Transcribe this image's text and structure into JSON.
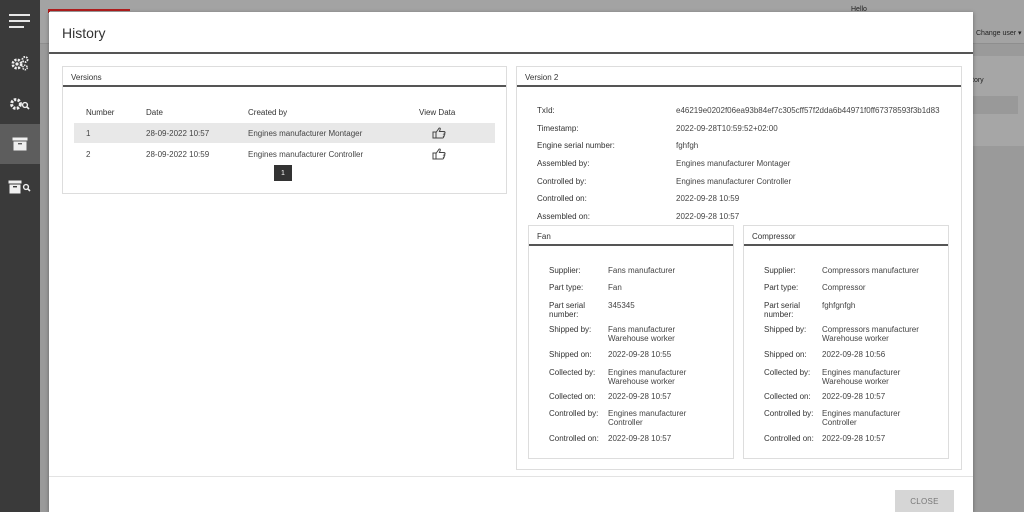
{
  "background": {
    "hello": "Hello",
    "change_user": "Change user ▾",
    "card_text": "tory"
  },
  "modal": {
    "title": "History",
    "close_label": "CLOSE"
  },
  "versions": {
    "title": "Versions",
    "columns": [
      "Number",
      "Date",
      "Created by",
      "View Data"
    ],
    "rows": [
      {
        "number": "1",
        "date": "28-09-2022 10:57",
        "created_by": "Engines manufacturer Montager"
      },
      {
        "number": "2",
        "date": "28-09-2022 10:59",
        "created_by": "Engines manufacturer Controller"
      }
    ],
    "page": "1"
  },
  "version_detail": {
    "title": "Version 2",
    "fields": [
      {
        "label": "TxId:",
        "value": "e46219e0202f06ea93b84ef7c305cff57f2dda6b44971f0ff67378593f3b1d83"
      },
      {
        "label": "Timestamp:",
        "value": "2022-09-28T10:59:52+02:00"
      },
      {
        "label": "Engine serial number:",
        "value": "fghfgh"
      },
      {
        "label": "Assembled by:",
        "value": "Engines manufacturer Montager"
      },
      {
        "label": "Controlled by:",
        "value": "Engines manufacturer Controller"
      },
      {
        "label": "Controlled on:",
        "value": "2022-09-28 10:59"
      },
      {
        "label": "Assembled on:",
        "value": "2022-09-28 10:57"
      }
    ]
  },
  "fan": {
    "title": "Fan",
    "fields": [
      {
        "label": "Supplier:",
        "value": "Fans manufacturer"
      },
      {
        "label": "Part type:",
        "value": "Fan"
      },
      {
        "label": "Part serial number:",
        "value": "345345"
      },
      {
        "label": "Shipped by:",
        "value": "Fans manufacturer Warehouse worker"
      },
      {
        "label": "Shipped on:",
        "value": "2022-09-28 10:55"
      },
      {
        "label": "Collected by:",
        "value": "Engines manufacturer Warehouse worker"
      },
      {
        "label": "Collected on:",
        "value": "2022-09-28 10:57"
      },
      {
        "label": "Controlled by:",
        "value": "Engines manufacturer Controller"
      },
      {
        "label": "Controlled on:",
        "value": "2022-09-28 10:57"
      }
    ]
  },
  "compressor": {
    "title": "Compressor",
    "fields": [
      {
        "label": "Supplier:",
        "value": "Compressors manufacturer"
      },
      {
        "label": "Part type:",
        "value": "Compressor"
      },
      {
        "label": "Part serial number:",
        "value": "fghfgnfgh"
      },
      {
        "label": "Shipped by:",
        "value": "Compressors manufacturer Warehouse worker"
      },
      {
        "label": "Shipped on:",
        "value": "2022-09-28 10:56"
      },
      {
        "label": "Collected by:",
        "value": "Engines manufacturer Warehouse worker"
      },
      {
        "label": "Collected on:",
        "value": "2022-09-28 10:57"
      },
      {
        "label": "Controlled by:",
        "value": "Engines manufacturer Controller"
      },
      {
        "label": "Controlled on:",
        "value": "2022-09-28 10:57"
      }
    ]
  },
  "sidebar": {
    "items": [
      {
        "icon": "menu-icon"
      },
      {
        "icon": "gears-icon"
      },
      {
        "icon": "gear-search-icon"
      },
      {
        "icon": "archive-icon",
        "active": true
      },
      {
        "icon": "archive-search-icon"
      }
    ]
  },
  "colors": {
    "sidebar": "#3a3a3a",
    "sidebar_active": "#5d5d5d",
    "accent_red": "#b11d1d",
    "row_stripe": "#e8e8e8"
  }
}
